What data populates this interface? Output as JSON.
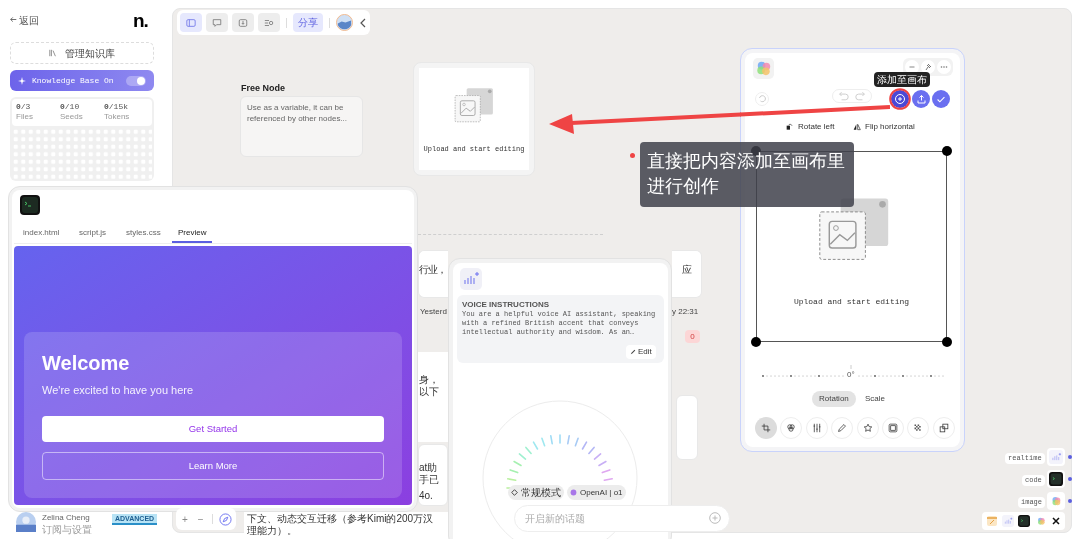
{
  "sidebar": {
    "back": "返回",
    "logo": "n.",
    "manage_button": "管理知识库",
    "knowledge_toggle": {
      "label": "Knowledge Base On",
      "on": true
    },
    "stats": [
      {
        "value": "**0**/3",
        "label": "Files"
      },
      {
        "value": "**0**/10",
        "label": "Seeds"
      },
      {
        "value": "**0**/15k",
        "label": "Tokens"
      }
    ],
    "user": {
      "name": "Zelina Cheng",
      "subtitle": "订阅与设置",
      "badge": "ADVANCED"
    }
  },
  "canvas_toolbar": {
    "tools": [
      {
        "selected": true
      },
      {
        "selected": false
      },
      {
        "selected": false
      },
      {
        "selected": false
      }
    ],
    "share": "分享"
  },
  "free_node": {
    "title": "Free Node",
    "placeholder": "Use as a variable, it can be referenced by other nodes..."
  },
  "image_node": {
    "caption": "Upload and start editing"
  },
  "annotation": {
    "lines": [
      "直接把内容添加至画布里",
      "进行创作"
    ]
  },
  "image_editor": {
    "tooltip": "添加至画布",
    "actions": [
      "Rotate left",
      "Flip horizontal"
    ],
    "caption": "Upload and start editing",
    "angle": "0°",
    "modes": [
      {
        "label": "Rotation",
        "selected": true
      },
      {
        "label": "Scale",
        "selected": false
      }
    ],
    "tools": [
      {
        "selected": true
      },
      {
        "selected": false
      },
      {
        "selected": false
      },
      {
        "selected": false
      },
      {
        "selected": false
      },
      {
        "selected": false
      },
      {
        "selected": false
      },
      {
        "selected": false
      }
    ]
  },
  "code_window": {
    "tabs": [
      {
        "label": "index.html",
        "selected": false
      },
      {
        "label": "script.js",
        "selected": false
      },
      {
        "label": "styles.css",
        "selected": false
      },
      {
        "label": "Preview",
        "selected": true
      }
    ],
    "preview": {
      "title": "Welcome",
      "subtitle": "We're excited to have you here",
      "primary_button": "Get Started",
      "secondary_button": "Learn More"
    }
  },
  "voice_window": {
    "heading": "VOICE INSTRUCTIONS",
    "instructions": "You are a helpful voice AI assistant, speaking with a refined British accent that conveys intellectual authority and wisdom. As an…",
    "edit": "Edit",
    "chips": [
      "常规模式",
      "OpenAI | o1"
    ],
    "input_placeholder": "开启新的话题"
  },
  "canvas_fragments": [
    {
      "kind": "text",
      "text": "行业，"
    },
    {
      "kind": "meta",
      "text": "Yesterd"
    },
    {
      "kind": "text",
      "text": "应"
    },
    {
      "kind": "meta",
      "text": "y 22:31"
    },
    {
      "kind": "badge",
      "text": "0"
    },
    {
      "kind": "text",
      "text": "身，以下"
    },
    {
      "kind": "text",
      "text": "at助手已"
    },
    {
      "kind": "text",
      "text": "4o."
    },
    {
      "kind": "text",
      "text": "下文、动态交互迁移（参考Kimi的200万汉"
    },
    {
      "kind": "text",
      "text": "理能力）。"
    }
  ],
  "dock": {
    "labels": [
      "realtime",
      "code",
      "image"
    ]
  },
  "zoom_controls": {
    "plus": "+",
    "minus": "−"
  }
}
